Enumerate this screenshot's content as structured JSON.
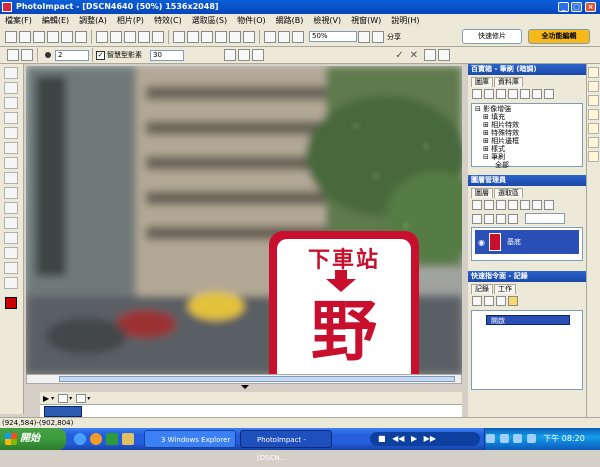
{
  "window": {
    "title": "PhotoImpact - [DSCN4640 (50%) 1536x2048]"
  },
  "menu": [
    "檔案(F)",
    "編輯(E)",
    "調整(A)",
    "相片(P)",
    "特效(C)",
    "選取區(S)",
    "物件(O)",
    "網路(B)",
    "檢視(V)",
    "視窗(W)",
    "說明(H)"
  ],
  "toolbar": {
    "zoom_value": "50%",
    "share_label": "分享",
    "mode_quick": "快速修片",
    "mode_full": "全功能編輯"
  },
  "attributes": {
    "brush_size": "2",
    "smart_label": "智慧型影素",
    "smart_checked": true,
    "value2": "30"
  },
  "panels": {
    "easy_palette": {
      "title": "百寶箱 - 筆刷 (暗調)",
      "tabs": [
        "圖庫",
        "資料庫"
      ],
      "tree": [
        "影像增強",
        "填充",
        "相片特效",
        "特殊特效",
        "相片邊框",
        "樣式",
        "筆刷",
        "全部"
      ]
    },
    "layer_manager": {
      "title": "圖層管理員",
      "tabs": [
        "圖層",
        "選取區"
      ],
      "layer_name": "基底"
    },
    "quick_command": {
      "title": "快速指令面 - 記錄",
      "tabs": [
        "記錄",
        "工作"
      ],
      "entry": "開啟"
    }
  },
  "canvas": {
    "sign_top": "下車站",
    "sign_char": "野"
  },
  "statusbar": {
    "coords": "(924,584)-(902,804)"
  },
  "taskbar": {
    "start": "開始",
    "items": [
      "3 Windows Explorer",
      "PhotoImpact - [DSCN..."
    ],
    "clock": "下午 08:20"
  },
  "colors": {
    "title_blue": "#0845b9",
    "sign_red": "#c8102e",
    "layer_sel": "#2a4fb6"
  }
}
